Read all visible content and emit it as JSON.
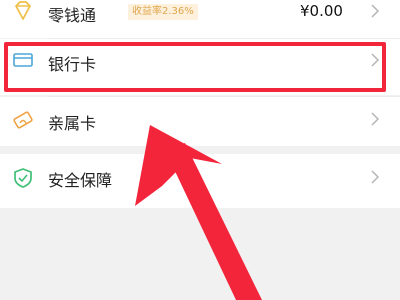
{
  "rows": [
    {
      "label": "零钱通",
      "badge": "收益率2.36%",
      "value": "¥0.00",
      "icon": "diamond-icon"
    },
    {
      "label": "银行卡",
      "icon": "bank-card-icon"
    },
    {
      "label": "亲属卡",
      "icon": "family-card-icon"
    },
    {
      "label": "安全保障",
      "icon": "shield-icon"
    }
  ],
  "colors": {
    "highlight": "#f2253b",
    "diamond": "#f0c04a",
    "card": "#4aa6d8",
    "shield": "#3fbf76"
  }
}
